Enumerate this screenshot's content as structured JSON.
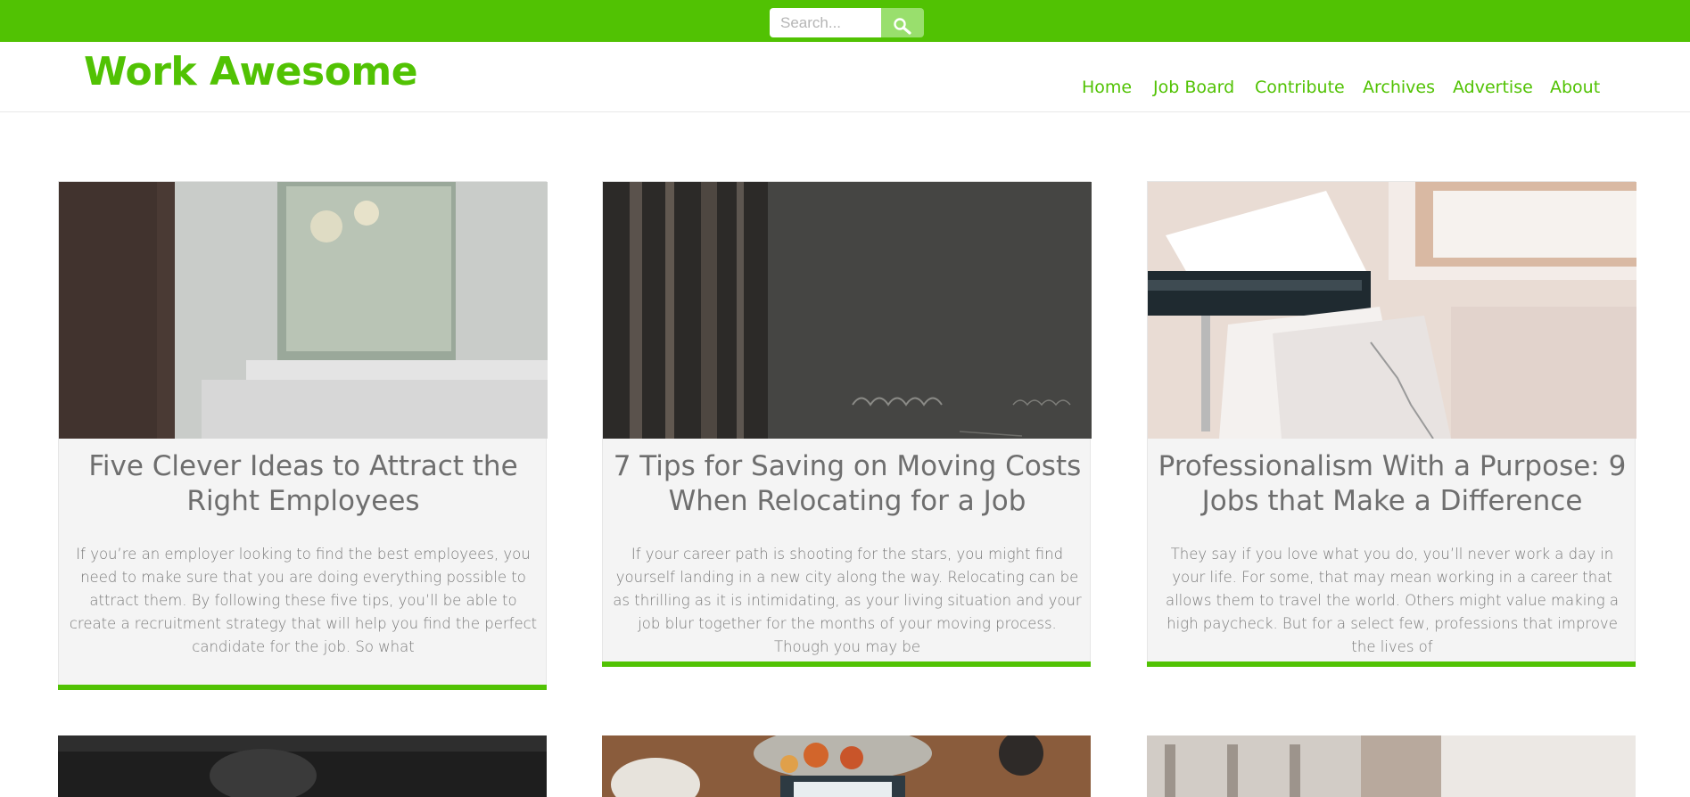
{
  "search": {
    "placeholder": "Search...",
    "button_icon": "search-icon"
  },
  "site": {
    "logo": "Work Awesome"
  },
  "nav": [
    {
      "label": "Home"
    },
    {
      "label": "Job Board"
    },
    {
      "label": "Contribute"
    },
    {
      "label": "Archives"
    },
    {
      "label": "Advertise"
    },
    {
      "label": "About"
    }
  ],
  "colors": {
    "accent": "#51c203",
    "search_button": "#99df6d",
    "card_bg": "#f4f4f4",
    "title_text": "#6e6e6e"
  },
  "posts": [
    {
      "title": "Five Clever Ideas to Attract the Right Employees",
      "excerpt": "If you’re an employer looking to find the best employees, you need to make sure that you are doing everything possible to attract them. By following these five tips, you’ll be able to create a recruitment strategy that will help you find the perfect candidate for the job. So what"
    },
    {
      "title": "7 Tips for Saving on Moving Costs When Relocating for a Job",
      "excerpt": "If your career path is shooting for the stars, you might find yourself landing in a new city along the way. Relocating can be as thrilling as it is intimidating, as your living situation and your job blur together for the months of your moving process.  Though you may be"
    },
    {
      "title": "Professionalism With a Purpose: 9 Jobs that Make a Difference",
      "excerpt": "They say if you love what you do, you’ll never work a day in your life. For some, that may mean working in a career that allows them to travel the world. Others might value making a high paycheck. But for a select few, professions that improve the lives of"
    }
  ]
}
